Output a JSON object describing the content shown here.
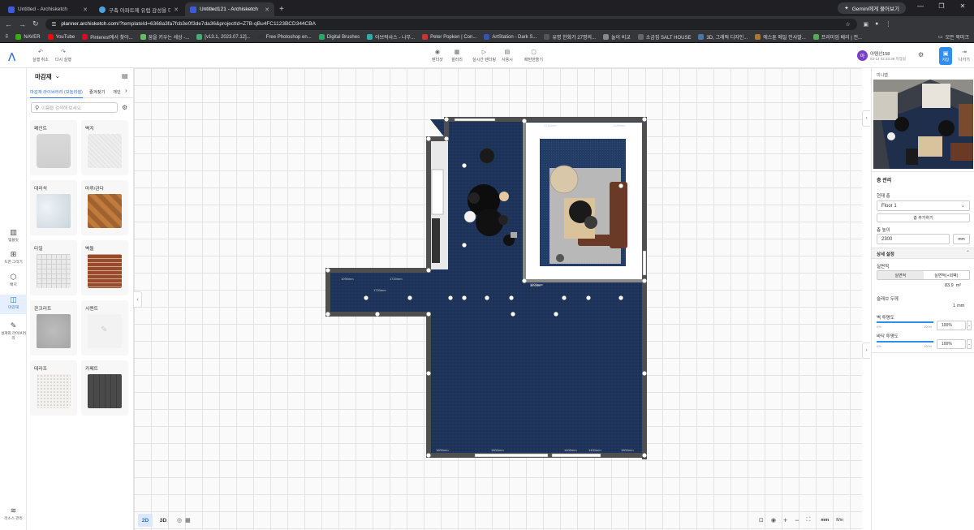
{
  "browser": {
    "tabs": [
      {
        "label": "Untitled - Archisketch",
        "active": false
      },
      {
        "label": "구축 아파트에 유럽 감성을 더...",
        "active": false
      },
      {
        "label": "Untitled121 - Archisketch",
        "active": true
      }
    ],
    "gemini_label": "Gemini에게 물어보기",
    "url_host": "planner.archisketch.com",
    "url_path": "/?templateId=6368a3fa7fcb3e0f3de7da36&projectId=Z7B-qBu4FC1123BCD344CBA",
    "bookmarks": [
      "NAVER",
      "YouTube",
      "Pinterest에서 찾아...",
      "꿈을 키우는 세상 -...",
      "[v13.1, 2023.07.12]...",
      "Free Photoshop en...",
      "Digital Brushes",
      "아브락사스 - 나무...",
      "Peter Popken | Con...",
      "ArtStation - Dark S...",
      "유명 한화가 27명의...",
      "놀이 비교",
      "소금집 SALT HOUSE",
      "3D, 그래픽 디자인...",
      "에스툰 메일 인사말...",
      "프리미엄 베리 | 전..."
    ],
    "all_bookmarks": "모든 북마크"
  },
  "toolbar": {
    "undo": "실행 취소",
    "redo": "다시 실행",
    "center_tools": [
      "렌더샷",
      "갤러리",
      "실시간 렌더링",
      "사용시",
      "패턴만들기"
    ],
    "user_name": "아템선158",
    "user_time": "03-14 02:33:39 저장됨",
    "save_label": "저장",
    "exit_label": "나가기",
    "avatar_letter": "아"
  },
  "rail": [
    "템플릿",
    "도면 그리기",
    "배치",
    "마감재",
    "설계와 라이브러리",
    "리소스 관리"
  ],
  "panel": {
    "title": "마감재",
    "tabs": [
      "마감재 라이브러리 (모놀리썸)",
      "즐겨찾기",
      "개인"
    ],
    "search_placeholder": "이름을 검색해 보세요",
    "materials": [
      {
        "name": "페인트"
      },
      {
        "name": "벽지"
      },
      {
        "name": "대리석"
      },
      {
        "name": "마루/관다"
      },
      {
        "name": "타일"
      },
      {
        "name": "벽돌"
      },
      {
        "name": "콘크리트"
      },
      {
        "name": "시멘트"
      },
      {
        "name": "테라조"
      },
      {
        "name": "카페트"
      }
    ]
  },
  "canvas": {
    "view_2d": "2D",
    "view_3d": "3D",
    "unit_mm": "mm",
    "unit_ftin": "ft/in",
    "dim_labels": [
      "2176mm",
      "1285mm",
      "1090mm",
      "1720mm",
      "1720mm",
      "1600mm",
      "1600mm",
      "1900mm",
      "1600mm",
      "1400mm",
      "1400mm"
    ],
    "area_label": "36.09m²"
  },
  "right": {
    "minimap_title": "미니맵",
    "section_title": "층 관리",
    "floor_label": "현재 층",
    "floor_value": "Floor 1",
    "add_floor": "층 추가하기",
    "height_label": "층 높이",
    "height_value": "2300",
    "height_unit": "mm",
    "detail_title": "상세 설정",
    "floor_material_label": "실면적",
    "toggle_a": "실면적",
    "toggle_b": "실면적(+외벽)",
    "area_value": "83.9",
    "area_unit": "m²",
    "wall_thick_label": "슬래브 두께",
    "wall_thick_value": "1",
    "wall_thick_unit": "mm",
    "wall_opacity_label": "벽 투명도",
    "floor_opacity_label": "바닥 투명도",
    "min": "0%",
    "max": "100%",
    "wall_opacity": "100%",
    "floor_opacity": "100%"
  }
}
